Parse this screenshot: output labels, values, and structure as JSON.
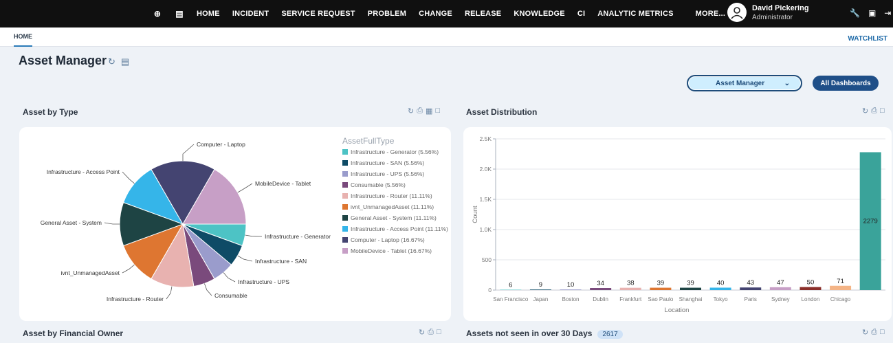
{
  "nav": {
    "items": [
      "HOME",
      "INCIDENT",
      "SERVICE REQUEST",
      "PROBLEM",
      "CHANGE",
      "RELEASE",
      "KNOWLEDGE",
      "CI",
      "ANALYTIC METRICS",
      "MORE..."
    ],
    "icons": [
      "plus-circle-icon",
      "chat-icon"
    ]
  },
  "user": {
    "name": "David Pickering",
    "role": "Administrator"
  },
  "top_icons": [
    "wrench-icon",
    "help-icon",
    "logout-icon"
  ],
  "tabs": {
    "home": "HOME",
    "watchlist": "WATCHLIST"
  },
  "page": {
    "title": "Asset Manager",
    "dashboard_select": "Asset Manager",
    "all_dashboards": "All Dashboards"
  },
  "panels": {
    "asset_by_type": "Asset by Type",
    "asset_distribution": "Asset Distribution",
    "asset_by_financial_owner": "Asset by Financial Owner",
    "assets_not_seen": "Assets not seen in over 30 Days",
    "assets_not_seen_count": "2617"
  },
  "chart_data": [
    {
      "type": "pie",
      "legend_title": "AssetFullType",
      "legend_placement": "right",
      "slices": [
        {
          "label": "Infrastructure - Generator",
          "legend": "Infrastructure - Generator (5.56%)",
          "value": 5.56,
          "color": "#4dc3c5"
        },
        {
          "label": "Infrastructure - SAN",
          "legend": "Infrastructure - SAN (5.56%)",
          "value": 5.56,
          "color": "#0e4b66"
        },
        {
          "label": "Infrastructure - UPS",
          "legend": "Infrastructure - UPS (5.56%)",
          "value": 5.56,
          "color": "#9a9ccc"
        },
        {
          "label": "Consumable",
          "legend": "Consumable (5.56%)",
          "value": 5.56,
          "color": "#7a4a7c"
        },
        {
          "label": "Infrastructure - Router",
          "legend": "Infrastructure - Router (11.11%)",
          "value": 11.11,
          "color": "#e8b2b0"
        },
        {
          "label": "ivnt_UnmanagedAsset",
          "legend": "ivnt_UnmanagedAsset (11.11%)",
          "value": 11.11,
          "color": "#de7631"
        },
        {
          "label": "General Asset - System",
          "legend": "General Asset - System (11.11%)",
          "value": 11.11,
          "color": "#1e4444"
        },
        {
          "label": "Infrastructure - Access Point",
          "legend": "Infrastructure - Access Point (11.11%)",
          "value": 11.11,
          "color": "#35b5e9"
        },
        {
          "label": "Computer - Laptop",
          "legend": "Computer - Laptop (16.67%)",
          "value": 16.67,
          "color": "#444471"
        },
        {
          "label": "MobileDevice - Tablet",
          "legend": "MobileDevice - Tablet (16.67%)",
          "value": 16.67,
          "color": "#c79fc6"
        }
      ]
    },
    {
      "type": "bar",
      "xlabel": "Location",
      "ylabel": "Count",
      "ylim": [
        0,
        2500
      ],
      "yticks": [
        0,
        500,
        1000,
        1500,
        2000,
        2500
      ],
      "ytick_labels": [
        "0",
        "500",
        "1.0K",
        "1.5K",
        "2.0K",
        "2.5K"
      ],
      "grid": true,
      "categories": [
        "San Francisco",
        "Japan",
        "Boston",
        "Dublin",
        "Frankfurt",
        "Sao Paulo",
        "Shanghai",
        "Tokyo",
        "Paris",
        "Sydney",
        "London",
        "Chicago",
        ""
      ],
      "values": [
        6,
        9,
        10,
        34,
        38,
        39,
        39,
        40,
        43,
        47,
        50,
        71,
        2279
      ],
      "value_labels": [
        "6",
        "9",
        "10",
        "34",
        "38",
        "39",
        "39",
        "40",
        "43",
        "47",
        "50",
        "71",
        "2279"
      ],
      "colors": [
        "#4dc3c5",
        "#0e4b66",
        "#9a9ccc",
        "#7a4a7c",
        "#e8b2b0",
        "#de7631",
        "#1e4444",
        "#35b5e9",
        "#444471",
        "#c79fc6",
        "#8b2f2a",
        "#f4b486",
        "#3aa39a"
      ]
    }
  ]
}
